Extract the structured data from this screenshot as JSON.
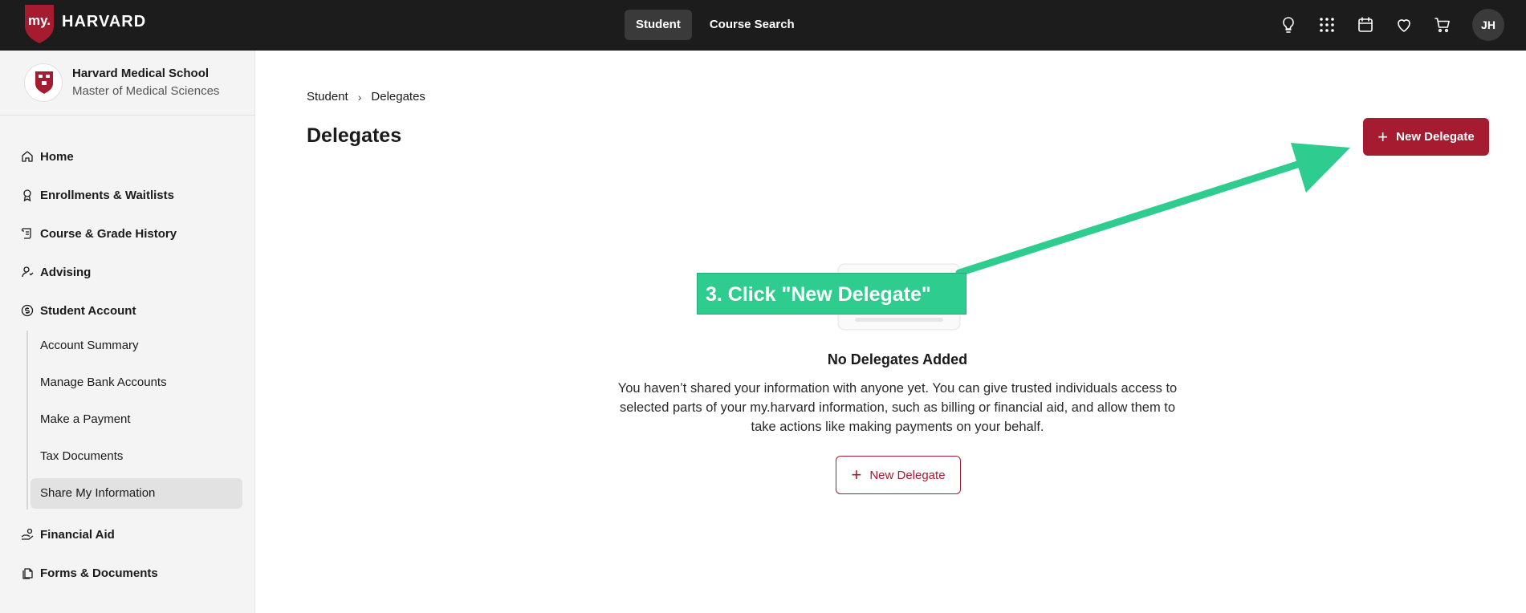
{
  "header": {
    "logo_prefix": "my.",
    "logo_text": "HARVARD",
    "nav": [
      {
        "label": "Student",
        "active": true
      },
      {
        "label": "Course Search",
        "active": false
      }
    ],
    "icons": [
      "lightbulb-icon",
      "apps-grid-icon",
      "calendar-icon",
      "heart-icon",
      "cart-icon"
    ],
    "avatar_initials": "JH"
  },
  "sidebar": {
    "school_name": "Harvard Medical School",
    "program": "Master of Medical Sciences",
    "items": [
      {
        "label": "Home",
        "icon": "home-icon"
      },
      {
        "label": "Enrollments & Waitlists",
        "icon": "award-icon"
      },
      {
        "label": "Course & Grade History",
        "icon": "scroll-icon"
      },
      {
        "label": "Advising",
        "icon": "person-icon"
      },
      {
        "label": "Student Account",
        "icon": "dollar-circle-icon"
      },
      {
        "label": "Financial Aid",
        "icon": "hand-coins-icon"
      },
      {
        "label": "Forms & Documents",
        "icon": "documents-icon"
      }
    ],
    "student_account_subitems": [
      {
        "label": "Account Summary",
        "active": false
      },
      {
        "label": "Manage Bank Accounts",
        "active": false
      },
      {
        "label": "Make a Payment",
        "active": false
      },
      {
        "label": "Tax Documents",
        "active": false
      },
      {
        "label": "Share My Information",
        "active": true
      }
    ]
  },
  "main": {
    "breadcrumb": [
      "Student",
      "Delegates"
    ],
    "title": "Delegates",
    "new_button_label": "New Delegate",
    "empty_title": "No Delegates Added",
    "empty_description": "You haven’t shared your information with anyone yet. You can give trusted individuals access to selected parts of your my.harvard information, such as billing or financial aid, and allow them to take actions like making payments on your behalf.",
    "empty_button_label": "New Delegate"
  },
  "annotation": {
    "label": "3. Click \"New Delegate\"",
    "color": "#2ecc8f"
  },
  "colors": {
    "brand_crimson": "#a51c30",
    "topbar": "#1c1c1c",
    "sidebar_bg": "#f4f4f4"
  }
}
